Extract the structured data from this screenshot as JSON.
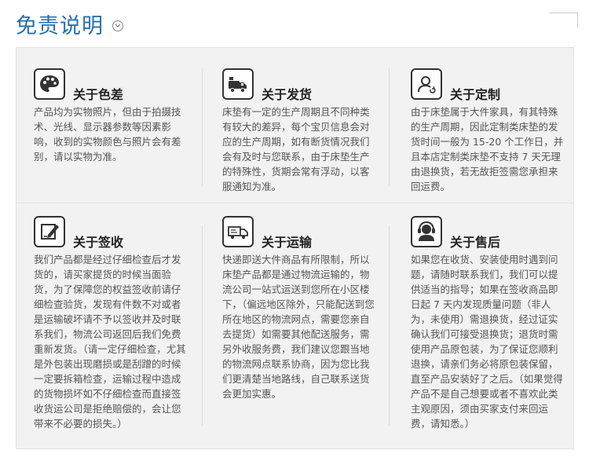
{
  "header": {
    "title": "免责说明"
  },
  "cards": [
    {
      "title": "关于色差",
      "icon": "palette-icon",
      "body": "产品均为实物照片，但由于拍摄技术、光线、显示器参数等因素影响，收到的实物颜色与照片会有差别，请以实物为准。"
    },
    {
      "title": "关于发货",
      "icon": "delivery-truck-icon",
      "body": "床垫有一定的生产周期且不同种类有较大的差异，每个宝贝信息会对应的生产周期，如有断货情况我们会有及时与您联系，由于床垫生产的特殊性，货期会常有浮动，以客服通知为准。"
    },
    {
      "title": "关于定制",
      "icon": "user-profile-icon",
      "body": "由于床垫属于大件家具，有其特殊的生产周期，因此定制类床垫的发货时间一般为 15-20 个工作日，并且本店定制类床垫不支持 7 天无理由退换货，若无故拒签需您承担来回运费。"
    },
    {
      "title": "关于签收",
      "icon": "edit-pen-icon",
      "body": "我们产品都是经过仔细检查后才发货的，请买家提货的时候当面验货，为了保障您的权益签收前请仔细检查验货，发现有件数不对或者是运输破坏请不予以签收并及时联系我们，物流公司返回后我们免费重新发货。（请一定仔细检查，尤其是外包装出现磨损或是刮蹭的时候一定要拆箱检查，运输过程中造成的货物损坏如不仔细检查而直接签收货运公司是拒绝赔偿的，会让您带来不必要的损失。）"
    },
    {
      "title": "关于运输",
      "icon": "shipping-truck-icon",
      "body": "快递即送大件商品有所限制，所以床垫产品都是通过物流运输的，物流公司一站式运送到您所在小区楼下，（偏远地区除外，只能配送到您所在地区的物流网点，需要您亲自去提货）如需要其他配送服务，需另外收服务费，我们建议您跟当地的物流网点联系协商，因为您比我们更清楚当地路线，自己联系送货会更加实惠。"
    },
    {
      "title": "关于售后",
      "icon": "customer-service-icon",
      "body": "如果您在收货、安装使用时遇到问题，请随时联系我们，我们可以提供适当的指导；如果在签收商品即日起 7 天内发现质量问题（非人为，未使用）需退换货，经过证实确认我们可接受退换货；退货时需使用产品原包装，为了保证您顺利退换，请亲们务必将原包装保留，直至产品安装好了之后。（如果觉得产品不是自己想要或者不喜欢此类主观原因，须由买家支付来回运费，请知悉。）"
    }
  ]
}
